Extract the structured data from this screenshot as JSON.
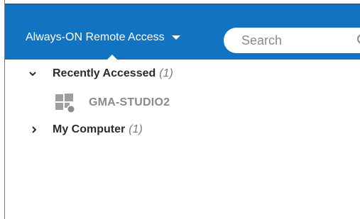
{
  "header": {
    "menu_label": "Always-ON Remote Access",
    "search": {
      "placeholder": "Search"
    }
  },
  "tree": {
    "groups": [
      {
        "label": "Recently Accessed",
        "count": "(1)",
        "expanded": true,
        "items": [
          {
            "name": "GMA-STUDIO2",
            "icon": "windows-computer-offline-icon"
          }
        ]
      },
      {
        "label": "My Computer",
        "count": "(1)",
        "expanded": false
      }
    ]
  },
  "colors": {
    "header_bg": "#1373c3",
    "header_text": "#ffffff",
    "group_text": "#2b2b2b",
    "count_text": "#7a7a7a",
    "offline_item_text": "#8a8a8a"
  }
}
